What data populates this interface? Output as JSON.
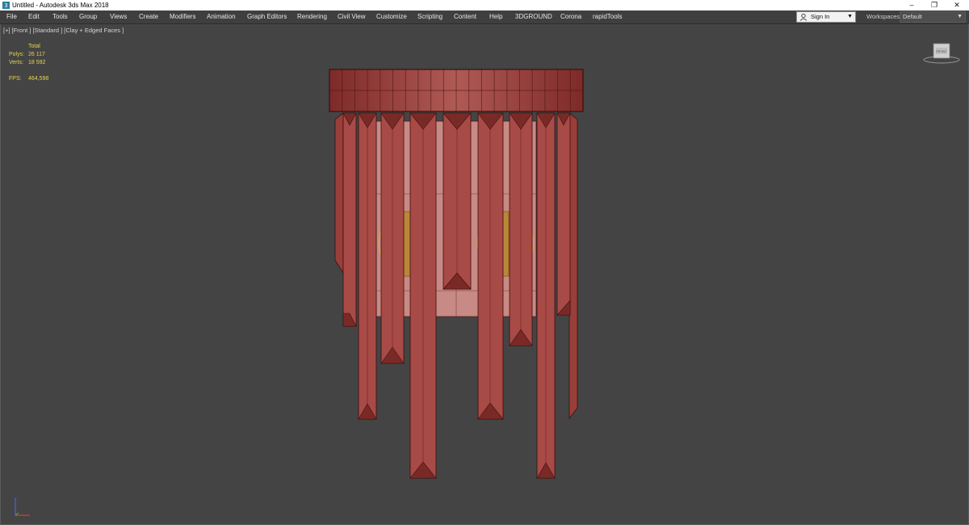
{
  "window": {
    "title": "Untitled - Autodesk 3ds Max 2018",
    "controls": {
      "minimize": "–",
      "restore": "❐",
      "close": "✕"
    }
  },
  "menu": {
    "items": [
      "File",
      "Edit",
      "Tools",
      "Group",
      "Views",
      "Create",
      "Modifiers",
      "Animation",
      "Graph Editors",
      "Rendering",
      "Civil View",
      "Customize",
      "Scripting",
      "Content",
      "Help",
      "3DGROUND",
      "Corona",
      "rapidTools"
    ],
    "sign_in": "Sign In",
    "workspaces_label": "Workspaces:",
    "workspace_value": "Default"
  },
  "viewport": {
    "label": "[+] [Front ] [Standard ] [Clay + Edged Faces ]",
    "stats": {
      "header": "Total",
      "polys_label": "Polys:",
      "polys_value": "26 117",
      "verts_label": "Verts:",
      "verts_value": "18 592",
      "fps_label": "FPS:",
      "fps_value": "464,598"
    },
    "viewcube_label": "FRONT"
  },
  "colors": {
    "viewport_bg": "#444444",
    "model_fill": "#a84a46",
    "model_edge": "#3b0f0f",
    "stats_text": "#e8d44a"
  }
}
